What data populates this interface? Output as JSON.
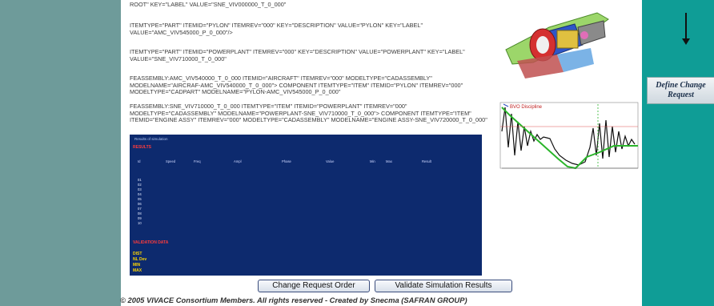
{
  "xml_lines": [
    "ROOT\" KEY=\"LABEL\" VALUE=\"SNE_VIV000000_T_0_000\"",
    "ITEMTYPE=\"PART\" ITEMID=\"PYLON\" ITEMREV=\"000\" KEY=\"DESCRIPTION\" VALUE=\"PYLON\" KEY=\"LABEL\" VALUE=\"AMC_VIV545000_P_0_000\"/>",
    "ITEMTYPE=\"PART\" ITEMID=\"POWERPLANT\" ITEMREV=\"000\" KEY=\"DESCRIPTION\" VALUE=\"POWERPLANT\" KEY=\"LABEL\" VALUE=\"SNE_VIV710000_T_0_000\"",
    "FEASSEMBLY:AMC_VIV540000_T_0_000 ITEMID=\"AIRCRAFT\" ITEMREV=\"000\" MODELTYPE=\"CADASSEMBLY\" MODELNAME=\"AIRCRAF-AMC_VIV540000_T_0_000\"> COMPONENT ITEMTYPE=\"ITEM\" ITEMID=\"PYLON\" ITEMREV=\"000\" MODELTYPE=\"CADPART\" MODELNAME=\"PYLON-AMC_VIV545000_P_0_000\"",
    "FEASSEMBLY:SNE_VIV710000_T_0_000 ITEMTYPE=\"ITEM\" ITEMID=\"POWERPLANT\" ITEMREV=\"000\" MODELTYPE=\"CADASSEMBLY\" MODELNAME=\"POWERPLANT-SNE_VIV710000_T_0_000\"> COMPONENT ITEMTYPE=\"ITEM\" ITEMID=\"ENGINE ASSY\" ITEMREV=\"000\" MODELTYPE=\"CADASSEMBLY\" MODELNAME=\"ENGINE ASSY-SNE_VIV720000_T_0_000\""
  ],
  "sidebar": {
    "define_change_request": "Define Change Request"
  },
  "chart_inset": {
    "legend_label": "BVO Discipline"
  },
  "results_panel": {
    "section_title_1": "RESULTS",
    "section_title_2": "VALIDATION DATA",
    "summary_labels": [
      "DIST",
      "NL Dev",
      "MIN",
      "MAX"
    ]
  },
  "buttons": {
    "change_request_order": "Change Request Order",
    "validate_simulation_results": "Validate Simulation Results"
  },
  "footer": {
    "copyright": "© 2005 VIVACE Consortium Members. All rights reserved - Created by Snecma (SAFRAN GROUP)"
  },
  "colors": {
    "left_panel": "#6e9b9a",
    "right_panel": "#0f9d96",
    "results_background": "#0d2a6e"
  }
}
